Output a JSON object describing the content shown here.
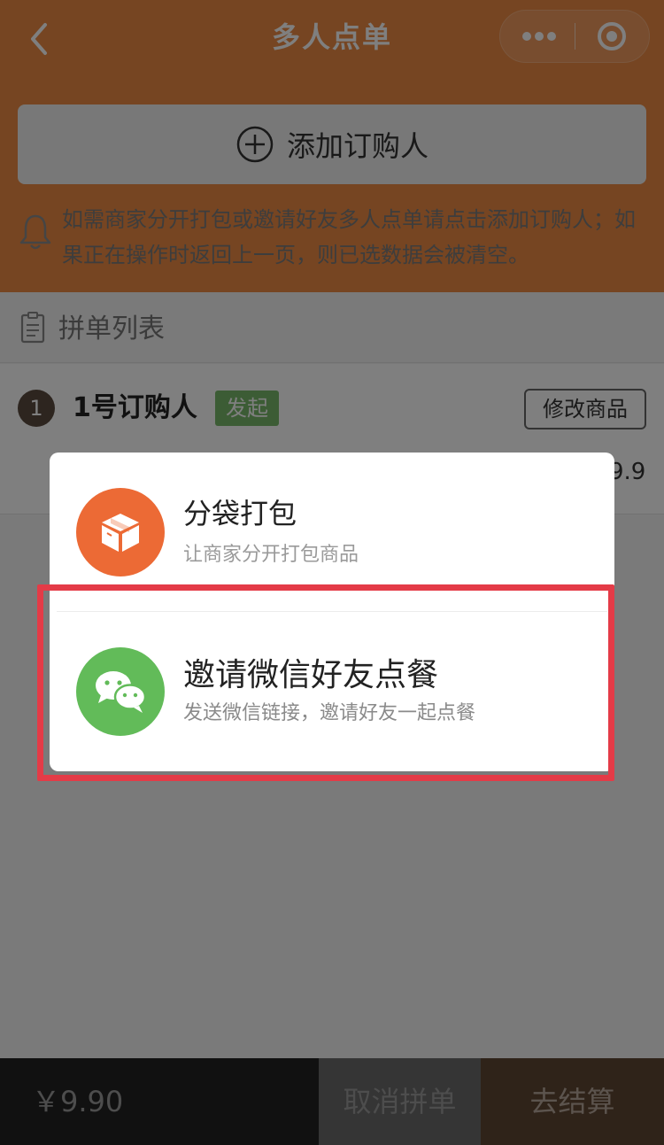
{
  "header": {
    "title": "多人点单",
    "back_icon": "chevron-left-icon",
    "more_icon": "more-dots-icon",
    "close_icon": "target-circle-icon"
  },
  "add_purchaser": {
    "label": "添加订购人",
    "icon": "plus-circle-icon"
  },
  "tip": {
    "icon": "bell-icon",
    "text": "如需商家分开打包或邀请好友多人点单请点击添加订购人；如果正在操作时返回上一页，则已选数据会被清空。"
  },
  "order_list": {
    "icon": "clipboard-icon",
    "title": "拼单列表",
    "purchasers": [
      {
        "number": "1",
        "name": "1号订购人",
        "badge": "发起",
        "edit_label": "修改商品",
        "price_partial": "9.9"
      }
    ]
  },
  "modal": {
    "options": [
      {
        "icon": "box-icon",
        "title": "分袋打包",
        "description": "让商家分开打包商品"
      },
      {
        "icon": "wechat-icon",
        "title": "邀请微信好友点餐",
        "description": "发送微信链接，邀请好友一起点餐"
      }
    ]
  },
  "bottom_bar": {
    "total": "￥9.90",
    "cancel_label": "取消拼单",
    "checkout_label": "去结算"
  },
  "colors": {
    "brand_orange": "#ec8a44",
    "box_orange": "#ec6a35",
    "wechat_green": "#62bb59",
    "badge_green": "#79b96a",
    "highlight_red": "#e43b47"
  }
}
